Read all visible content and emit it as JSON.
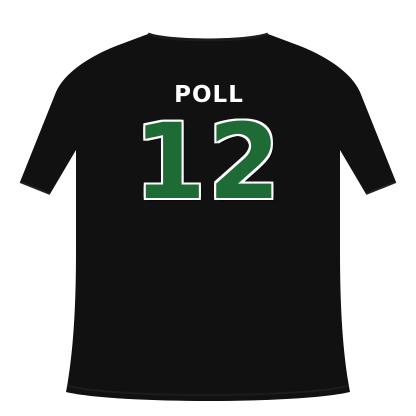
{
  "product": {
    "player_name": "POLL",
    "player_number": "12"
  },
  "colors": {
    "background": "#ffffff",
    "shirt": "#111111",
    "number_fill": "#1f6b35",
    "number_outline": "#ffffff",
    "name_color": "#ffffff"
  }
}
